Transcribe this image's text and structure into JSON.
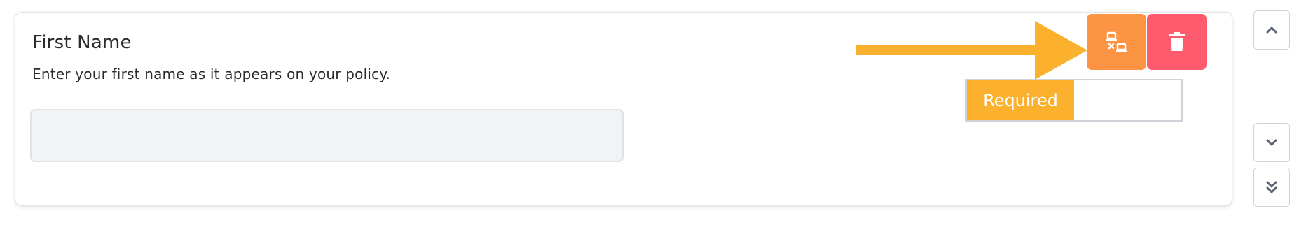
{
  "field": {
    "title": "First Name",
    "description": "Enter your first name as it appears on your policy.",
    "input_value": "",
    "input_placeholder": ""
  },
  "actions": {
    "network_icon": "disconnect-network-icon",
    "delete_icon": "trash-icon"
  },
  "toggle": {
    "active_label": "Required"
  },
  "side_controls": {
    "up_icon": "chevron-up-icon",
    "down_icon": "chevron-down-icon",
    "bottom_icon": "double-chevron-down-icon"
  },
  "colors": {
    "accent_orange": "#fc9444",
    "delete_red": "#ff5b6e",
    "toggle_active": "#fbb12d",
    "arrow": "#fbb12d",
    "input_bg": "#f2f3f5"
  }
}
